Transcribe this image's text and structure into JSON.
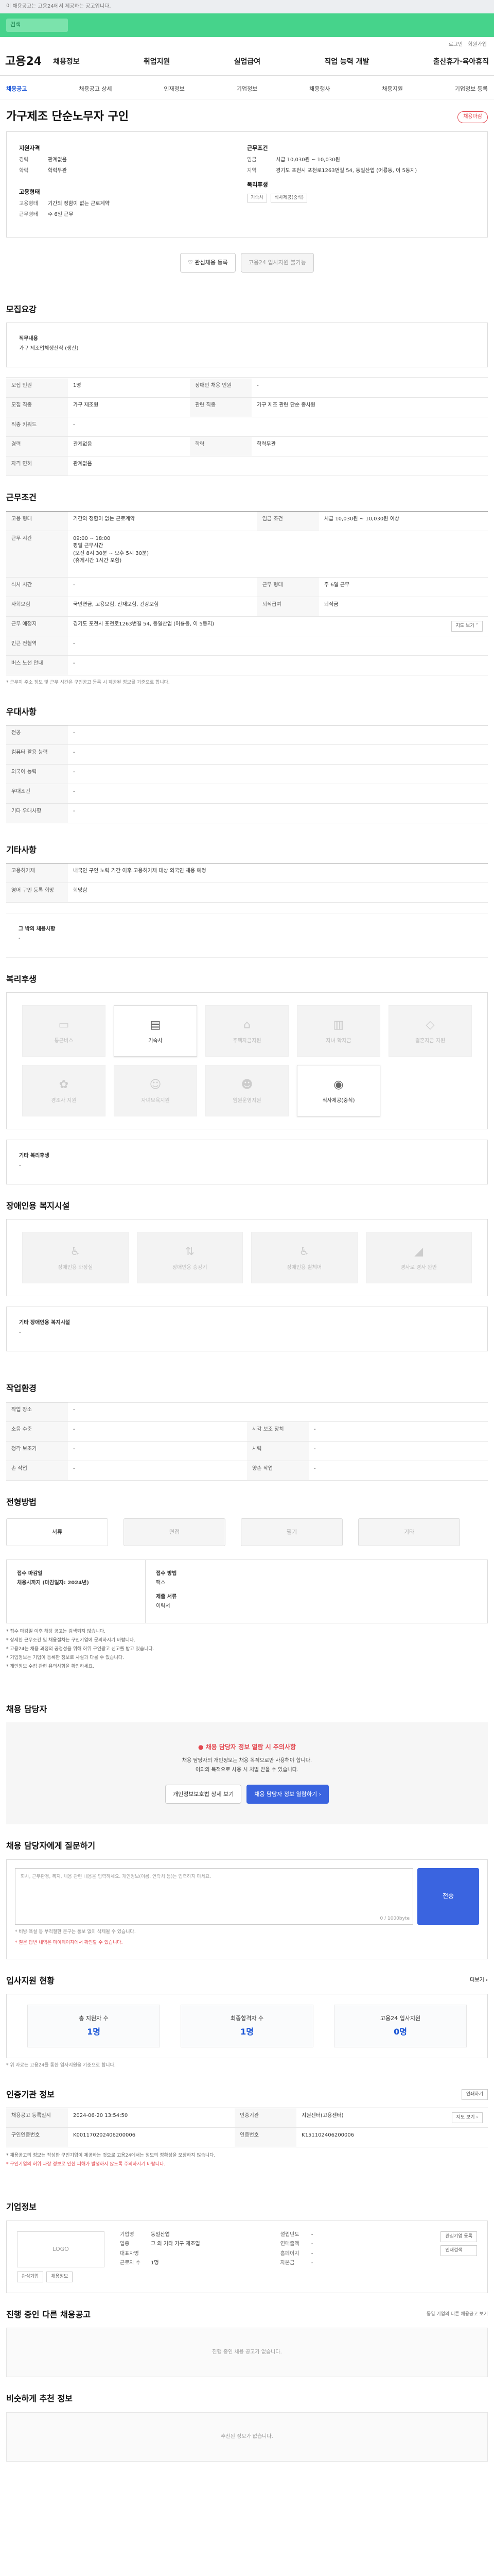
{
  "topbar": "이 채용공고는 고용24에서 제공하는 공고입니다.",
  "search": {
    "value": "검색"
  },
  "util": [
    "로그인",
    "회원가입"
  ],
  "logo": "고용24",
  "menu": [
    "채용정보",
    "취업지원",
    "실업급여",
    "직업 능력 개발",
    "출산휴가·육아휴직"
  ],
  "subnav": [
    "채용공고",
    "채용공고 상세",
    "인재정보",
    "기업정보",
    "채용행사",
    "채용지원",
    "기업정보 등록"
  ],
  "title": "가구제조 단순노무자 구인",
  "status_pill": "채용마감",
  "summary": {
    "h1": "지원자격",
    "k1": [
      "경력",
      "학력"
    ],
    "v1": [
      "관계없음",
      "학력무관"
    ],
    "h2": "고용형태",
    "k2": [
      "고용형태",
      "근무형태"
    ],
    "v2": [
      "기간의 정함이 없는 근로계약",
      "주 6일 근무"
    ],
    "h3": "근무조건",
    "k3": [
      "임금",
      "지역"
    ],
    "v3": [
      "시급 10,030원 ~ 10,030원",
      "경기도 포천시 포천로1263번길 54, 동일산업 (어룡동, 이 5동지)"
    ],
    "h4": "복리후생",
    "badges": [
      "기숙사",
      "식사제공(중식)"
    ]
  },
  "actions": {
    "scrap": "관심채용 등록",
    "apply": "고용24 입사지원 불가능"
  },
  "recruit": {
    "title": "모집요강",
    "job_h": "직무내용",
    "job_v": "가구 제조업체생산직 (생산)",
    "rows": [
      [
        "모집 인원",
        "1명",
        "장애인 채용 인원",
        "-"
      ],
      [
        "모집 직종",
        "가구 제조원",
        "관련 직종",
        "가구 제조 관련 단순 종사원"
      ],
      [
        "직종 키워드",
        "-",
        "",
        ""
      ],
      [
        "경력",
        "관계없음",
        "학력",
        "학력무관"
      ],
      [
        "자격 면허",
        "관계없음",
        "",
        ""
      ]
    ]
  },
  "cond": {
    "title": "근무조건",
    "rows": [
      [
        "고용 형태",
        "기간의 정함이 없는 근로계약",
        "임금 조건",
        "시급 10,030원 ~ 10,030원 이상"
      ],
      [
        "근무 시간",
        "09:00 ~ 18:00",
        "",
        ""
      ],
      [
        "식사 시간",
        "-",
        "근무 형태",
        "주 6일 근무"
      ],
      [
        "사회보험",
        "국민연금, 고용보험, 산재보험, 건강보험",
        "퇴직급여",
        "퇴직금"
      ],
      [
        "근무 예정지",
        "경기도 포천시 포천로1263번길 54, 동일산업 (어룡동, 이 5동지)",
        "",
        ""
      ],
      [
        "인근 전철역",
        "-",
        "",
        ""
      ],
      [
        "버스 노선 안내",
        "-",
        "",
        ""
      ]
    ],
    "time_extra": [
      "평일 근무시간",
      "(오전 8시 30분 ~ 오후 5시 30분)",
      "(휴게시간 1시간 포함)"
    ],
    "map_btn": "지도 보기 ˅",
    "note": "* 근무지 주소 정보 및 근무 시간은 구인공고 등록 시 제공된 정보를 기준으로 합니다."
  },
  "pref": {
    "title": "우대사항",
    "rows": [
      [
        "전공",
        "-"
      ],
      [
        "컴퓨터 활용 능력",
        "-"
      ],
      [
        "외국어 능력",
        "-"
      ],
      [
        "우대조건",
        "-"
      ],
      [
        "기타 우대사항",
        "-"
      ]
    ]
  },
  "etc": {
    "title": "기타사항",
    "rows": [
      [
        "고용허가제",
        "내국인 구인 노력 기간 이후 고용허가제 대상 외국인 채용 예정"
      ],
      [
        "영어 구인 등록 희망",
        "희망함"
      ]
    ],
    "req_h": "그 밖의 채용사항",
    "req_v": "-"
  },
  "welfare": {
    "title": "복리후생",
    "items": [
      "통근버스",
      "기숙사",
      "주택자금지원",
      "자녀 학자금",
      "결혼자금 지원",
      "경조사 지원",
      "자녀보육지원",
      "임원운영지원",
      "식사제공(중식)"
    ],
    "on": [
      1,
      8
    ],
    "etc_h": "기타 복리후생",
    "etc_v": "-"
  },
  "disabled": {
    "title": "장애인용 복지시설",
    "items": [
      "장애인용 화장실",
      "장애인용 승강기",
      "장애인용 휠체어",
      "경사로 경사 완만"
    ],
    "etc_h": "기타 장애인용 복지시설",
    "etc_v": "-"
  },
  "env": {
    "title": "작업환경",
    "rows": [
      [
        "작업 장소",
        "-",
        "",
        ""
      ],
      [
        "소음 수준",
        "-",
        "시각 보조 장치",
        "-"
      ],
      [
        "청각 보조기",
        "-",
        "시력",
        "-"
      ],
      [
        "손 작업",
        "-",
        "양손 작업",
        "-"
      ]
    ]
  },
  "apply": {
    "title": "전형방법",
    "tabs": [
      "서류",
      "면접",
      "필기",
      "기타"
    ],
    "deadline_h": "접수 마감일",
    "deadline_v": "채용시까지 (마감일자: 2024년)",
    "method_h": "접수 방법",
    "method_v": "팩스",
    "docs_h": "제출 서류",
    "docs_v": "이력서",
    "notes": [
      "* 접수 마감일 이후 해당 공고는 검색되지 않습니다.",
      "* 상세한 근무조건 및 채용절차는 구인기업에 문의하시기 바랍니다.",
      "* 고용24는 채용 과정의 공정성을 위해 허위 구인광고 신고를 받고 있습니다.",
      "* 기업정보는 기업이 등록한 정보로 사실과 다를 수 있습니다.",
      "* 개인정보 수집 관련 유의사항을 확인하세요."
    ]
  },
  "contact": {
    "title": "채용 담당자",
    "alert": "채용 담당자 정보 열람 시 주의사항",
    "line1": "채용 담당자의 개인정보는 채용 목적으로만 사용해야 합니다.",
    "line2": "이외의 목적으로 사용 시 처벌 받을 수 있습니다.",
    "btn1": "개인정보보호법 상세 보기",
    "btn2": "채용 담당자 정보 열람하기 ›"
  },
  "inquiry": {
    "title": "채용 담당자에게 질문하기",
    "placeholder": "회사, 근무환경, 복지, 채용 관련 내용을 입력하세요. 개인정보(이름, 연락처 등)는 입력하지 마세요.",
    "count": "0 / 1000byte",
    "send": "전송",
    "n1": "* 비방·욕설 등 부적절한 문구는 통보 없이 삭제될 수 있습니다.",
    "n2": "* 질문 답변 내역은 마이페이지에서 확인할 수 있습니다."
  },
  "stats": {
    "title": "입사지원 현황",
    "more": "더보기 ›",
    "items": [
      [
        "총 지원자 수",
        "1명"
      ],
      [
        "최종합격자 수",
        "1명"
      ],
      [
        "고용24 입사지원",
        "0명"
      ]
    ],
    "note": "* 위 자료는 고용24를 통한 입사지원을 기준으로 합니다."
  },
  "info": {
    "title": "인증기관 정보",
    "print": "인쇄하기",
    "rows": [
      [
        "채용공고 등록일시",
        "2024-06-20 13:54:50",
        "인증기관",
        "지원센터(고용센터)"
      ],
      [
        "구인인증번호",
        "K001170202406200006",
        "인증번호",
        "K151102406200006"
      ]
    ],
    "btn": "지도 보기 ›",
    "notes": [
      "* 채용공고의 정보는 작성한 구인기업이 제공하는 것으로 고용24에서는 정보의 정확성을 보장하지 않습니다.",
      "* 구인기업의 허위·과장 정보로 인한 피해가 발생하지 않도록 주의하시기 바랍니다."
    ]
  },
  "company": {
    "title": "기업정보",
    "logo": "LOGO",
    "btns": [
      "관심기업 등록",
      "인재검색"
    ],
    "k": [
      "기업명",
      "업종",
      "대표자명",
      "근로자 수"
    ],
    "v": [
      "동일산업",
      "그 외 기타 가구 제조업",
      "",
      "1명"
    ],
    "k2": [
      "설립년도",
      "연매출액",
      "홈페이지",
      "자본금"
    ],
    "v2": [
      "-",
      "-",
      "-",
      "-"
    ],
    "side": [
      "관심기업",
      "채용정보"
    ]
  },
  "other": {
    "title": "진행 중인 다른 채용공고",
    "right": "동일 기업의 다른 채용공고 보기",
    "empty": "진행 중인 채용 공고가 없습니다."
  },
  "similar": {
    "title": "비슷하게 추천 정보",
    "empty": "추천된 정보가 없습니다."
  }
}
